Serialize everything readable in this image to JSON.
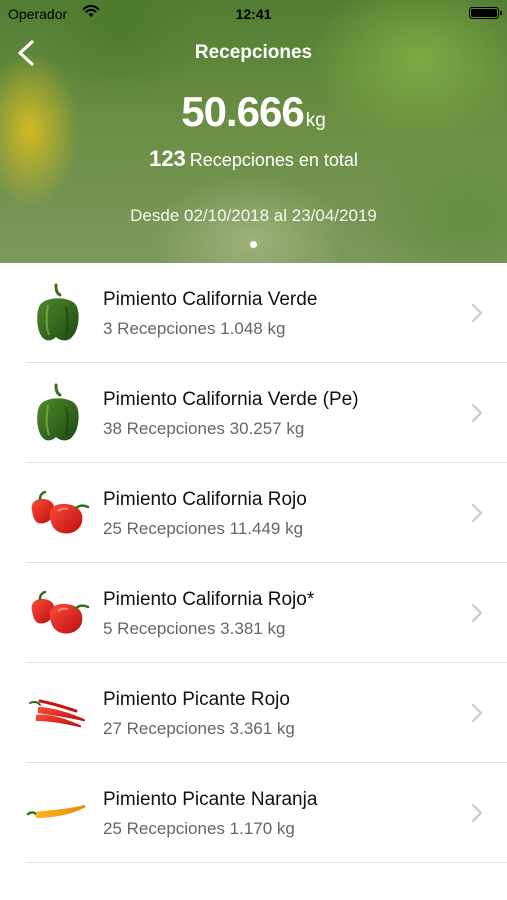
{
  "status_bar": {
    "carrier": "Operador",
    "time": "12:41"
  },
  "header": {
    "title": "Recepciones",
    "total_weight": "50.666",
    "total_unit": "kg",
    "receptions_count": "123",
    "receptions_label": "Recepciones en total",
    "date_range": "Desde 02/10/2018 al 23/04/2019"
  },
  "items": [
    {
      "name": "Pimiento California Verde",
      "detail": "3 Recepciones 1.048 kg",
      "icon": "green-pepper-icon"
    },
    {
      "name": "Pimiento California Verde (Pe)",
      "detail": "38 Recepciones 30.257 kg",
      "icon": "green-pepper-icon"
    },
    {
      "name": "Pimiento California Rojo",
      "detail": "25 Recepciones 11.449 kg",
      "icon": "red-peppers-icon"
    },
    {
      "name": "Pimiento California Rojo*",
      "detail": "5 Recepciones 3.381 kg",
      "icon": "red-peppers-icon"
    },
    {
      "name": "Pimiento Picante Rojo",
      "detail": "27 Recepciones 3.361 kg",
      "icon": "red-chili-icon"
    },
    {
      "name": "Pimiento Picante Naranja",
      "detail": "25 Recepciones 1.170 kg",
      "icon": "orange-chili-icon"
    }
  ],
  "colors": {
    "header_text": "#ffffff",
    "title_text": "#111111",
    "subtitle_text": "#666666",
    "separator": "#e2e2e2",
    "chevron": "#c7c7cc"
  }
}
